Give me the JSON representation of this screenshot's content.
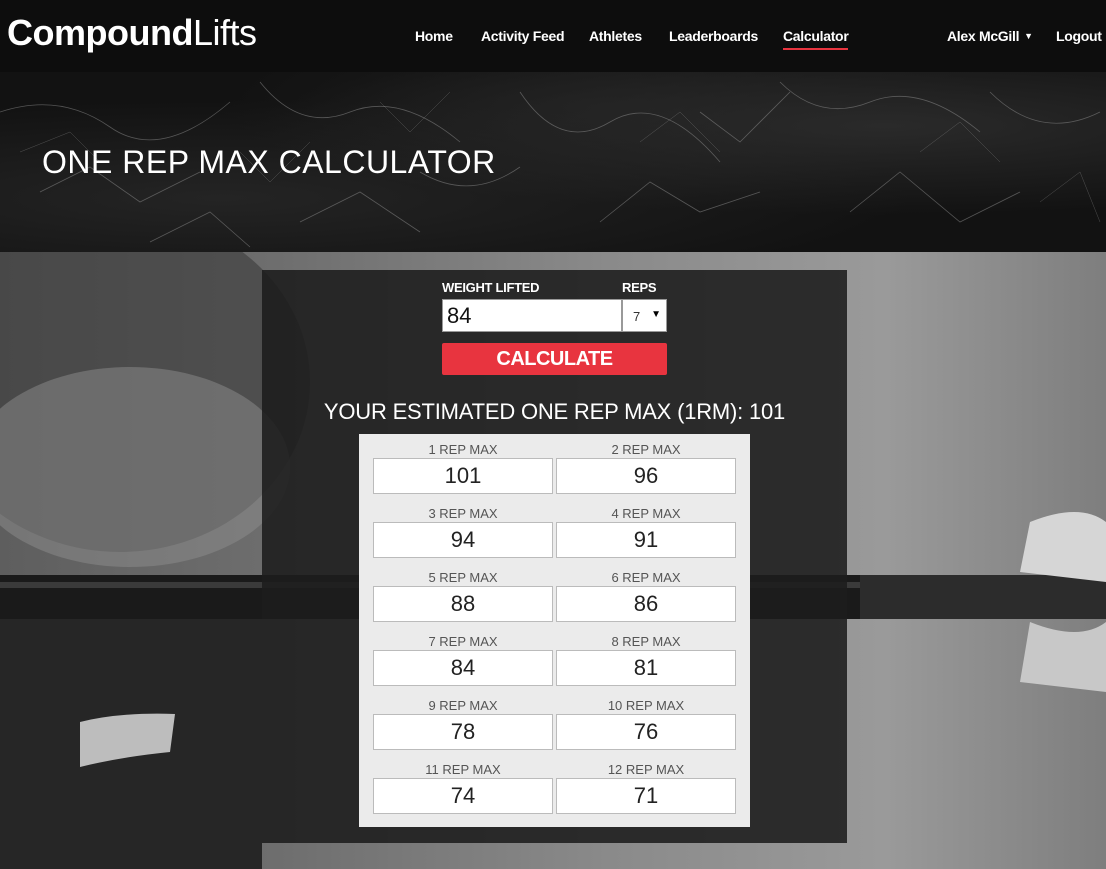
{
  "brand": {
    "bold": "Compound",
    "light": "Lifts"
  },
  "nav": {
    "items": [
      {
        "label": "Home"
      },
      {
        "label": "Activity Feed"
      },
      {
        "label": "Athletes"
      },
      {
        "label": "Leaderboards"
      },
      {
        "label": "Calculator",
        "active": true
      }
    ],
    "user": "Alex McGill",
    "logout": "Logout"
  },
  "hero": {
    "title": "ONE REP MAX CALCULATOR"
  },
  "calculator": {
    "weight_label": "WEIGHT LIFTED",
    "reps_label": "REPS",
    "weight_value": "84",
    "reps_value": "7",
    "button_label": "CALCULATE",
    "result_label": "YOUR ESTIMATED ONE REP MAX (1RM): 101",
    "table": [
      {
        "label": "1 REP MAX",
        "value": "101"
      },
      {
        "label": "2 REP MAX",
        "value": "96"
      },
      {
        "label": "3 REP MAX",
        "value": "94"
      },
      {
        "label": "4 REP MAX",
        "value": "91"
      },
      {
        "label": "5 REP MAX",
        "value": "88"
      },
      {
        "label": "6 REP MAX",
        "value": "86"
      },
      {
        "label": "7 REP MAX",
        "value": "84"
      },
      {
        "label": "8 REP MAX",
        "value": "81"
      },
      {
        "label": "9 REP MAX",
        "value": "78"
      },
      {
        "label": "10 REP MAX",
        "value": "76"
      },
      {
        "label": "11 REP MAX",
        "value": "74"
      },
      {
        "label": "12 REP MAX",
        "value": "71"
      }
    ]
  },
  "colors": {
    "accent": "#e8343f",
    "nav_bg": "#0d0d0d"
  }
}
